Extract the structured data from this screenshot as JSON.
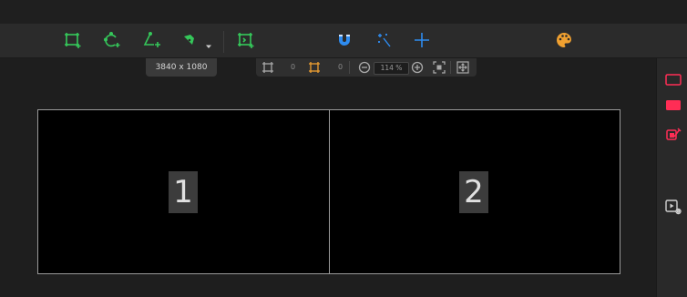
{
  "toolbar": {
    "tools": [
      {
        "icon": "rectangle-add-icon",
        "color": "#35c75a"
      },
      {
        "icon": "circle-add-icon",
        "color": "#35c75a"
      },
      {
        "icon": "triangle-add-icon",
        "color": "#35c75a"
      },
      {
        "icon": "pen-tool-icon",
        "color": "#35c75a"
      },
      {
        "icon": "chevron-down-icon",
        "color": "#cfcfcf"
      },
      {
        "icon": "fit-screen-add-icon",
        "color": "#35c75a"
      },
      {
        "icon": "magnet-icon",
        "color": "#2e8cf0"
      },
      {
        "icon": "magic-wand-icon",
        "color": "#2e8cf0"
      },
      {
        "icon": "crosshair-icon",
        "color": "#2e8cf0"
      },
      {
        "icon": "palette-icon",
        "color": "#f0a030"
      }
    ]
  },
  "resolution_badge": "3840 x 1080",
  "view_toolbar": {
    "values": [
      "0",
      "0"
    ],
    "zoom": "114 %"
  },
  "screens": [
    {
      "label": "1"
    },
    {
      "label": "2"
    }
  ],
  "right_panel": {
    "icons": [
      {
        "icon": "screen-outline-icon",
        "color": "#ff2d55"
      },
      {
        "icon": "screen-filled-icon",
        "color": "#ff2d55"
      },
      {
        "icon": "mask-edit-icon",
        "color": "#ff2d55"
      },
      {
        "icon": "media-settings-icon",
        "color": "#cfcfcf"
      }
    ]
  }
}
